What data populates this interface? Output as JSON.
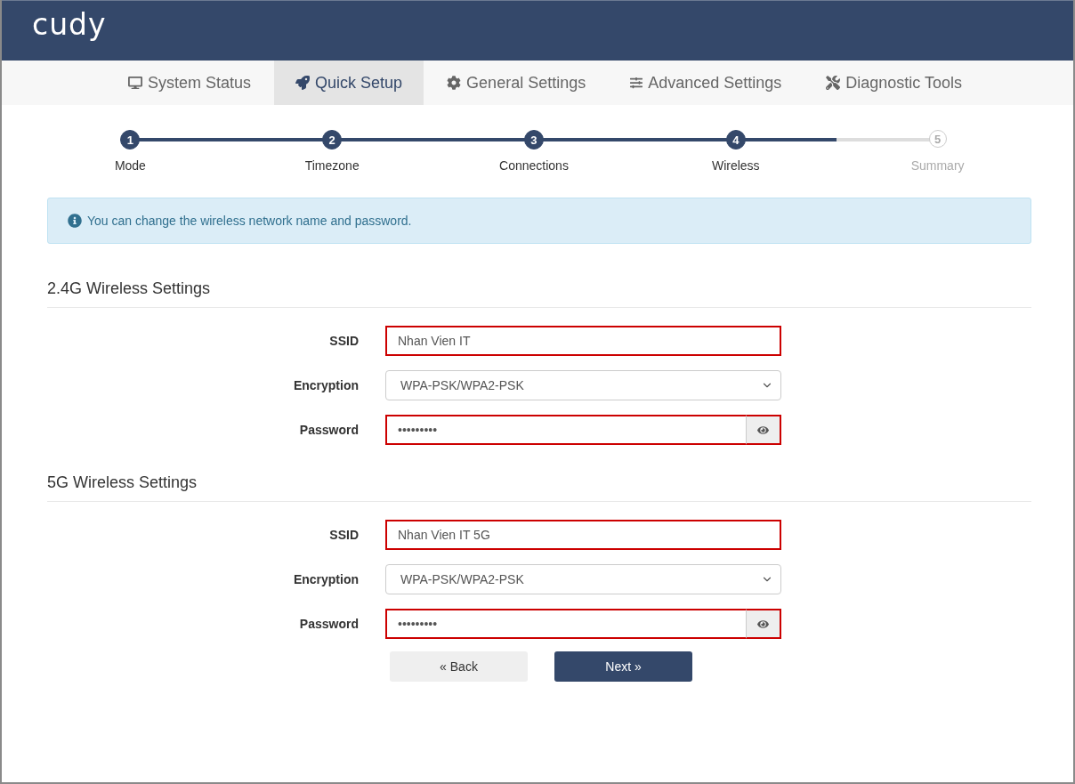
{
  "header": {
    "logo": "cudy"
  },
  "nav": [
    {
      "label": "System Status",
      "kind": "status",
      "selected": false
    },
    {
      "label": "Quick Setup",
      "kind": "setup",
      "selected": true
    },
    {
      "label": "General Settings",
      "kind": "general",
      "selected": false
    },
    {
      "label": "Advanced Settings",
      "kind": "advanced",
      "selected": false
    },
    {
      "label": "Diagnostic Tools",
      "kind": "diagnostic",
      "selected": false
    }
  ],
  "steps": [
    {
      "number": "1",
      "label": "Mode",
      "completed": true
    },
    {
      "number": "2",
      "label": "Timezone",
      "completed": true
    },
    {
      "number": "3",
      "label": "Connections",
      "completed": true
    },
    {
      "number": "4",
      "label": "Wireless",
      "completed": true
    },
    {
      "number": "5",
      "label": "Summary",
      "completed": false
    }
  ],
  "info": "You can change the wireless network name and password.",
  "sections": [
    {
      "title": "2.4G Wireless Settings",
      "fields": [
        {
          "kind": "text",
          "label": "SSID",
          "value": "Nhan Vien IT",
          "invalid": true
        },
        {
          "kind": "select",
          "label": "Encryption",
          "value": "WPA-PSK/WPA2-PSK",
          "invalid": false
        },
        {
          "kind": "password",
          "label": "Password",
          "value": "•••••••••",
          "invalid": true
        }
      ]
    },
    {
      "title": "5G Wireless Settings",
      "fields": [
        {
          "kind": "text",
          "label": "SSID",
          "value": "Nhan Vien IT 5G",
          "invalid": true
        },
        {
          "kind": "select",
          "label": "Encryption",
          "value": "WPA-PSK/WPA2-PSK",
          "invalid": false
        },
        {
          "kind": "password",
          "label": "Password",
          "value": "•••••••••",
          "invalid": true
        }
      ]
    }
  ],
  "buttons": [
    {
      "label": "« Back",
      "kind": "secondary"
    },
    {
      "label": "Next »",
      "kind": "primary"
    }
  ]
}
